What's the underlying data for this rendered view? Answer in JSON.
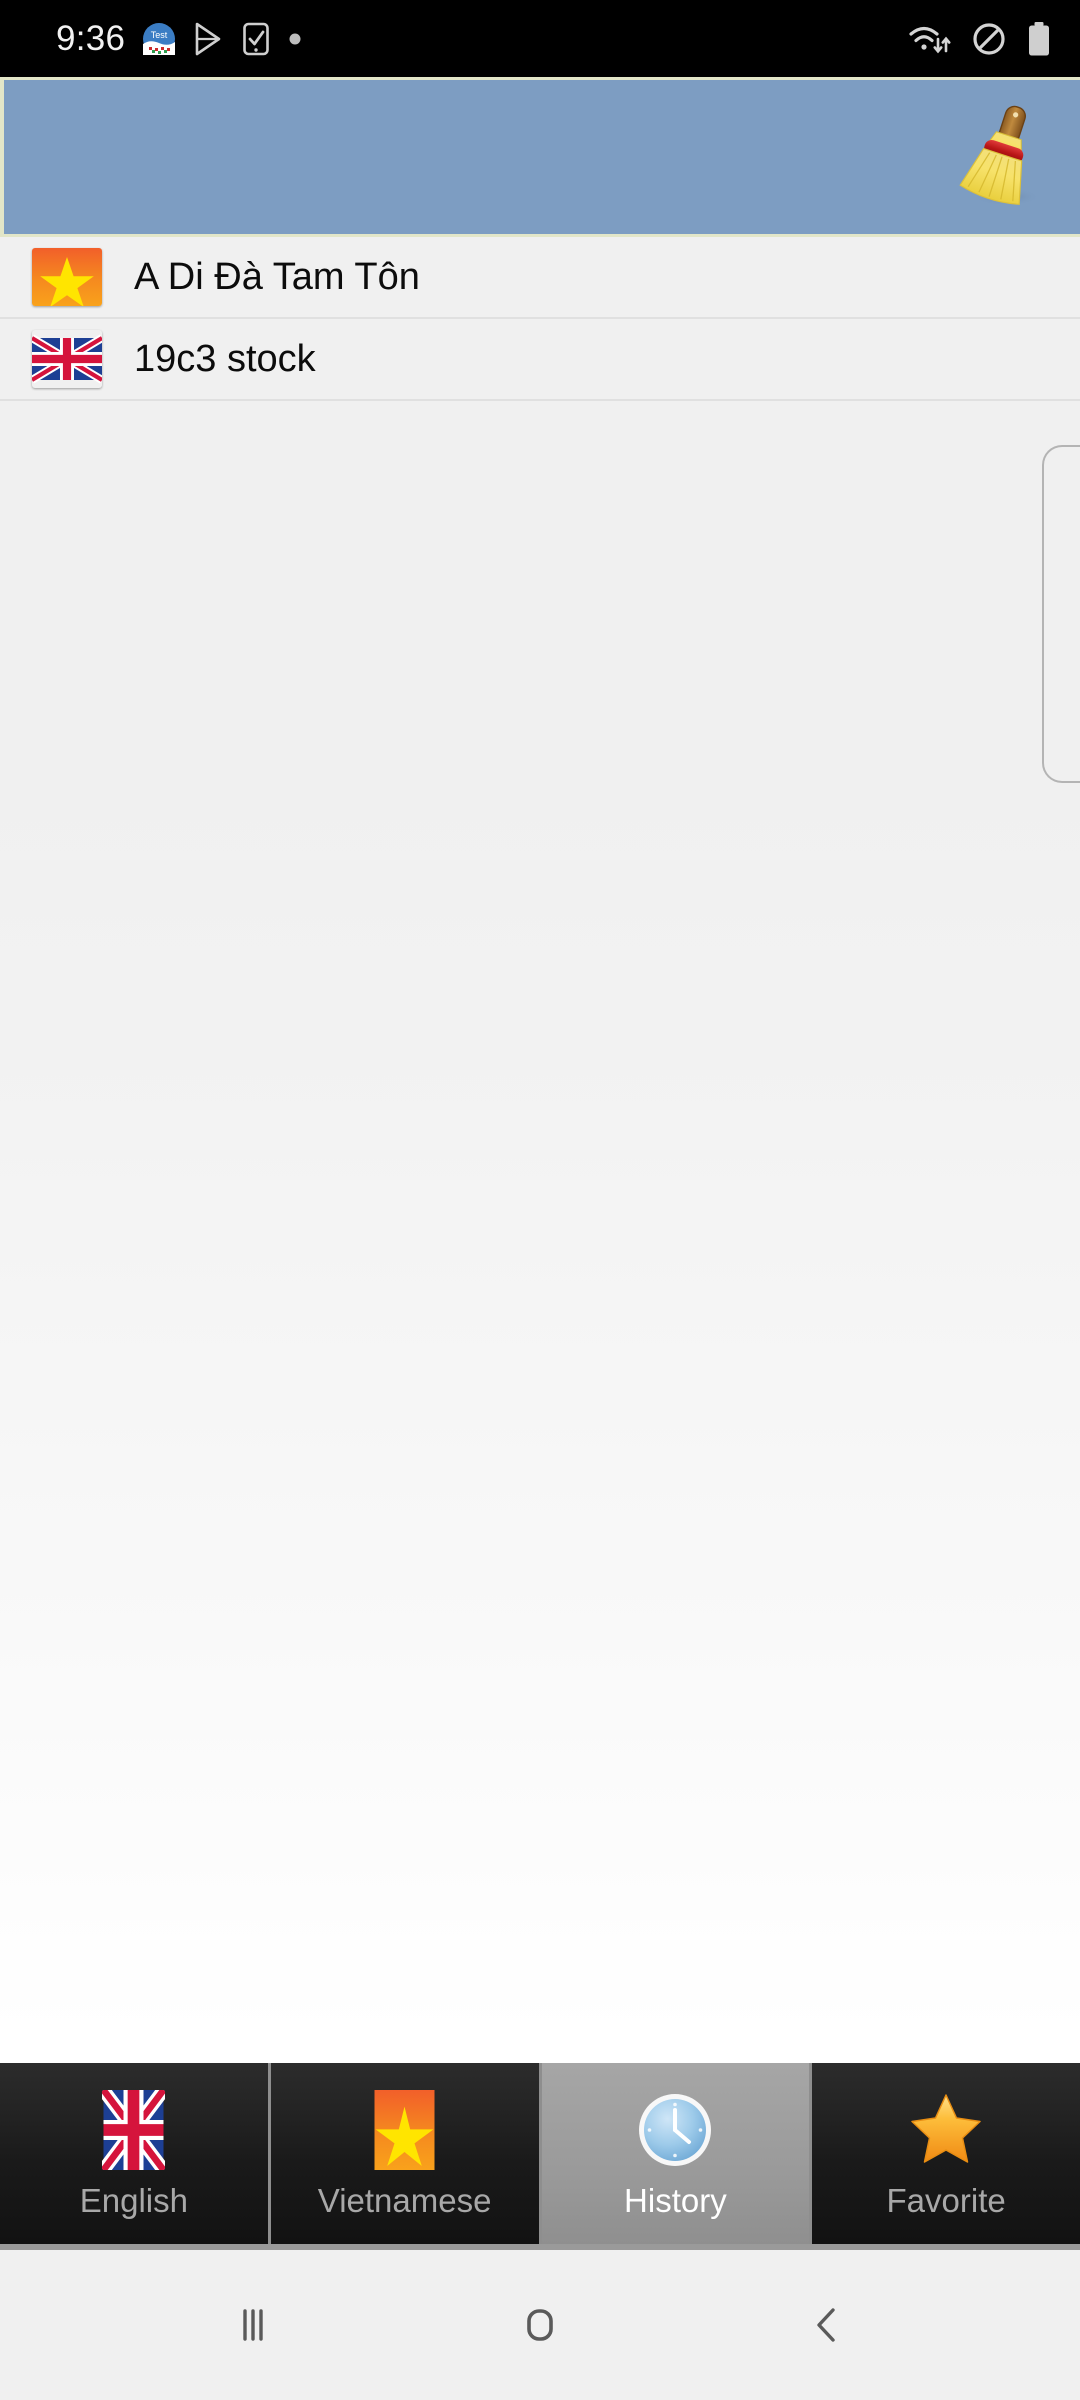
{
  "status_bar": {
    "time": "9:36",
    "left_icons": [
      {
        "name": "test-app-icon",
        "label": "Test"
      },
      {
        "name": "play-store-icon",
        "label": ""
      },
      {
        "name": "phone-check-icon",
        "label": ""
      },
      {
        "name": "notification-dot-icon",
        "label": ""
      }
    ],
    "right_icons": [
      {
        "name": "wifi-transfer-icon",
        "label": ""
      },
      {
        "name": "do-not-disturb-icon",
        "label": ""
      },
      {
        "name": "battery-icon",
        "label": ""
      }
    ],
    "background_color": "#000000"
  },
  "app_header": {
    "background_color": "#7d9dc2",
    "border_color": "#e2e6c8",
    "clear_button": {
      "name": "clear-history-button",
      "icon": "broom-icon",
      "tooltip": "Clear history"
    }
  },
  "history_list": {
    "items": [
      {
        "flag": "vietnam-flag-icon",
        "language": "Vietnamese",
        "label": "A Di Đà Tam Tôn"
      },
      {
        "flag": "uk-flag-icon",
        "language": "English",
        "label": "19c3 stock"
      }
    ],
    "background_top_color": "#f0f0f0",
    "background_bottom_color": "#ffffff",
    "scrollbar_visible": true
  },
  "tab_bar": {
    "selected_index": 2,
    "selected_background_color": "#9a9a9a",
    "unselected_background_color": "#1c1c1c",
    "tabs": [
      {
        "label": "English",
        "icon": "uk-flag-icon"
      },
      {
        "label": "Vietnamese",
        "icon": "vietnam-flag-icon"
      },
      {
        "label": "History",
        "icon": "clock-icon"
      },
      {
        "label": "Favorite",
        "icon": "star-icon"
      }
    ]
  },
  "nav_bar": {
    "background_color": "#f0f0f0",
    "buttons": [
      {
        "name": "recents-button",
        "icon": "recents-icon"
      },
      {
        "name": "home-button",
        "icon": "home-icon"
      },
      {
        "name": "back-button",
        "icon": "back-icon"
      }
    ]
  }
}
